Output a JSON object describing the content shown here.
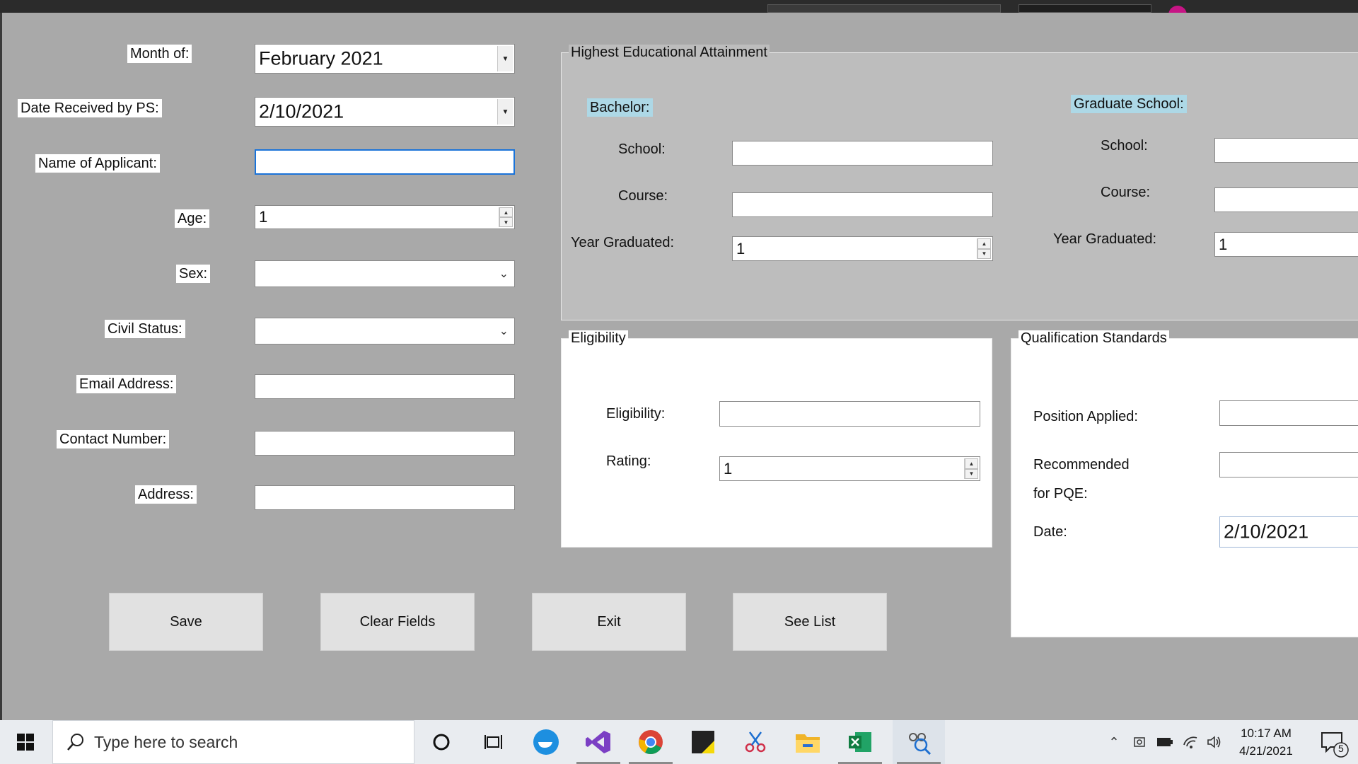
{
  "form": {
    "month_label": "Month of:",
    "month_value": "February 2021",
    "date_received_label": "Date Received by PS:",
    "date_received_value": "2/10/2021",
    "name_label": "Name of Applicant:",
    "name_value": "",
    "age_label": "Age:",
    "age_value": "1",
    "sex_label": "Sex:",
    "sex_value": "",
    "civil_status_label": "Civil Status:",
    "civil_status_value": "",
    "email_label": "Email Address:",
    "email_value": "",
    "contact_label": "Contact Number:",
    "contact_value": "",
    "address_label": "Address:",
    "address_value": ""
  },
  "education": {
    "title": "Highest Educational Attainment",
    "bachelor": {
      "heading": "Bachelor:",
      "school_label": "School:",
      "course_label": "Course:",
      "year_label": "Year Graduated:",
      "year_value": "1"
    },
    "graduate": {
      "heading": "Graduate School:",
      "school_label": "School:",
      "course_label": "Course:",
      "year_label": "Year Graduated:",
      "year_value": "1"
    }
  },
  "eligibility": {
    "title": "Eligibility",
    "eligibility_label": "Eligibility:",
    "rating_label": "Rating:",
    "rating_value": "1"
  },
  "qualification": {
    "title": "Qualification Standards",
    "position_label": "Position Applied:",
    "recommended_label_1": "Recommended",
    "recommended_label_2": "for PQE:",
    "date_label": "Date:",
    "date_value": "2/10/2021"
  },
  "buttons": {
    "save": "Save",
    "clear": "Clear Fields",
    "exit": "Exit",
    "see_list": "See List"
  },
  "taskbar": {
    "search_placeholder": "Type here to search",
    "time": "10:17 AM",
    "date": "4/21/2021",
    "notification_count": "5"
  }
}
